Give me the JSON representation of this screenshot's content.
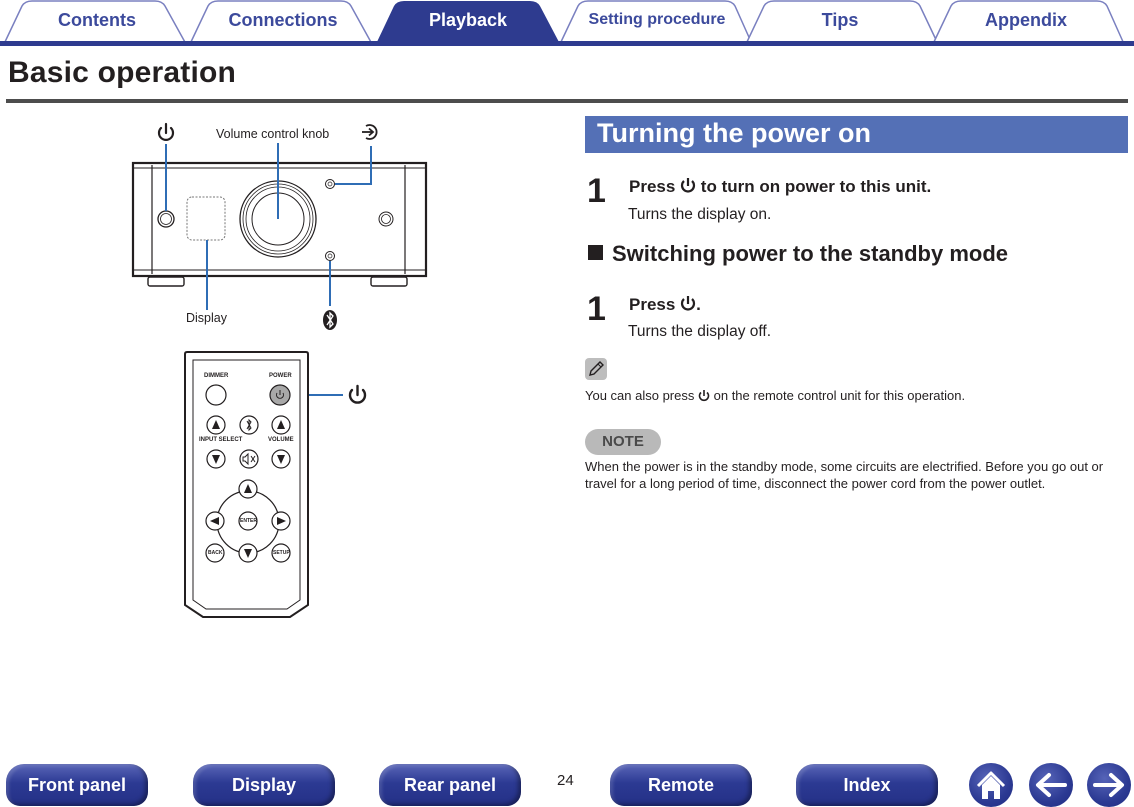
{
  "tabs": [
    {
      "label": "Contents",
      "active": false
    },
    {
      "label": "Connections",
      "active": false
    },
    {
      "label": "Playback",
      "active": true
    },
    {
      "label": "Setting procedure",
      "active": false
    },
    {
      "label": "Tips",
      "active": false
    },
    {
      "label": "Appendix",
      "active": false
    }
  ],
  "page": {
    "title": "Basic operation",
    "number": "24"
  },
  "colors": {
    "tab_accent": "#2e3b8f",
    "section_bar": "#5470b6",
    "leader_line": "#2f6db5",
    "note_badge": "#b9b9b9"
  },
  "illustration": {
    "front_panel": {
      "callouts": {
        "power": "power-icon",
        "volume": "Volume control knob",
        "input": "input-icon",
        "display": "Display",
        "bluetooth": "bluetooth-icon"
      }
    },
    "remote": {
      "labels": {
        "dimmer": "DIMMER",
        "power": "POWER",
        "input_select": "INPUT SELECT",
        "volume": "VOLUME",
        "enter": "ENTER",
        "back": "BACK",
        "setup": "SETUP"
      },
      "callout": "power-icon"
    }
  },
  "content": {
    "section_title": "Turning the power on",
    "step1": {
      "number": "1",
      "head_prefix": "Press",
      "head_suffix": "to turn on power to this unit.",
      "desc": "Turns the display on."
    },
    "subsection_title": "Switching power to the standby mode",
    "step2": {
      "number": "1",
      "head_prefix": "Press",
      "head_suffix": ".",
      "desc": "Turns the display off."
    },
    "tip": {
      "prefix": "You can also press",
      "suffix": "on the remote control unit for this operation."
    },
    "note": {
      "badge": "NOTE",
      "text": "When the power is in the standby mode, some circuits are electrified. Before you go out or travel for a long period of time, disconnect the power cord from the power outlet."
    }
  },
  "bottom_nav": {
    "buttons": [
      "Front panel",
      "Display",
      "Rear panel",
      "Remote",
      "Index"
    ],
    "icons": [
      "home-icon",
      "back-arrow-icon",
      "forward-arrow-icon"
    ]
  }
}
